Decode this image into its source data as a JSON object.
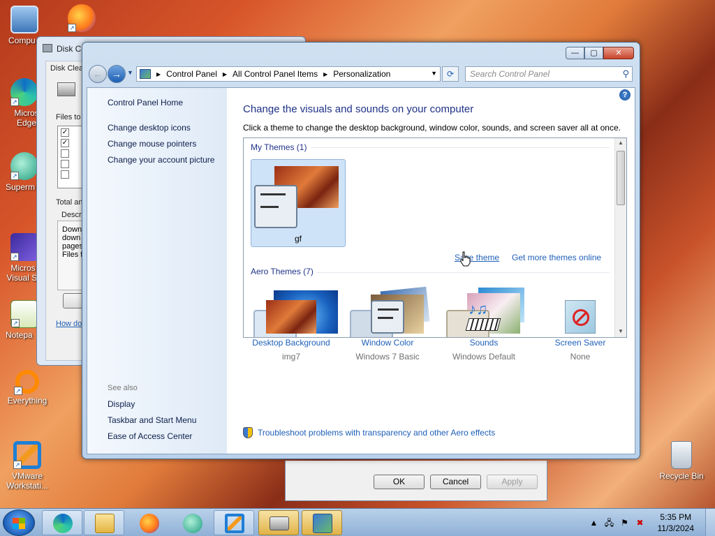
{
  "desktop": {
    "icons": [
      {
        "label": "Compu"
      },
      {
        "label": "Micros Edge"
      },
      {
        "label": "Superm"
      },
      {
        "label": "Micros Visual St"
      },
      {
        "label": "Notepa"
      },
      {
        "label": "Everything"
      },
      {
        "label": "VMware Workstati..."
      },
      {
        "label": "Recycle Bin"
      }
    ]
  },
  "disk_cleanup": {
    "title": "Disk Cle",
    "tab": "Disk Clea",
    "files_to": "Files to",
    "total": "Total an",
    "descr": "Descr",
    "desc_lines": [
      "Down",
      "down",
      "pages",
      "Files fo"
    ],
    "how_link": "How do"
  },
  "settings_dialog": {
    "ok": "OK",
    "cancel": "Cancel",
    "apply": "Apply"
  },
  "window": {
    "caption": {
      "min": "—",
      "max": "▢",
      "close": "✕"
    },
    "breadcrumb": [
      "Control Panel",
      "All Control Panel Items",
      "Personalization"
    ],
    "search_placeholder": "Search Control Panel"
  },
  "left_pane": {
    "home": "Control Panel Home",
    "links": [
      "Change desktop icons",
      "Change mouse pointers",
      "Change your account picture"
    ],
    "see_also": "See also",
    "see_also_links": [
      "Display",
      "Taskbar and Start Menu",
      "Ease of Access Center"
    ]
  },
  "main": {
    "heading": "Change the visuals and sounds on your computer",
    "subtext": "Click a theme to change the desktop background, window color, sounds, and screen saver all at once.",
    "my_themes_header": "My Themes (1)",
    "my_theme_name": "gf",
    "save_theme": "Save theme",
    "get_more": "Get more themes online",
    "aero_header": "Aero Themes (7)"
  },
  "bottom": [
    {
      "label": "Desktop Background",
      "value": "img7"
    },
    {
      "label": "Window Color",
      "value": "Windows 7 Basic"
    },
    {
      "label": "Sounds",
      "value": "Windows Default"
    },
    {
      "label": "Screen Saver",
      "value": "None"
    }
  ],
  "troubleshoot": "Troubleshoot problems with transparency and other Aero effects",
  "taskbar": {
    "time": "5:35 PM",
    "date": "11/3/2024"
  },
  "colors": {
    "heading_blue": "#1e3287",
    "link_blue": "#1e5fb8"
  }
}
